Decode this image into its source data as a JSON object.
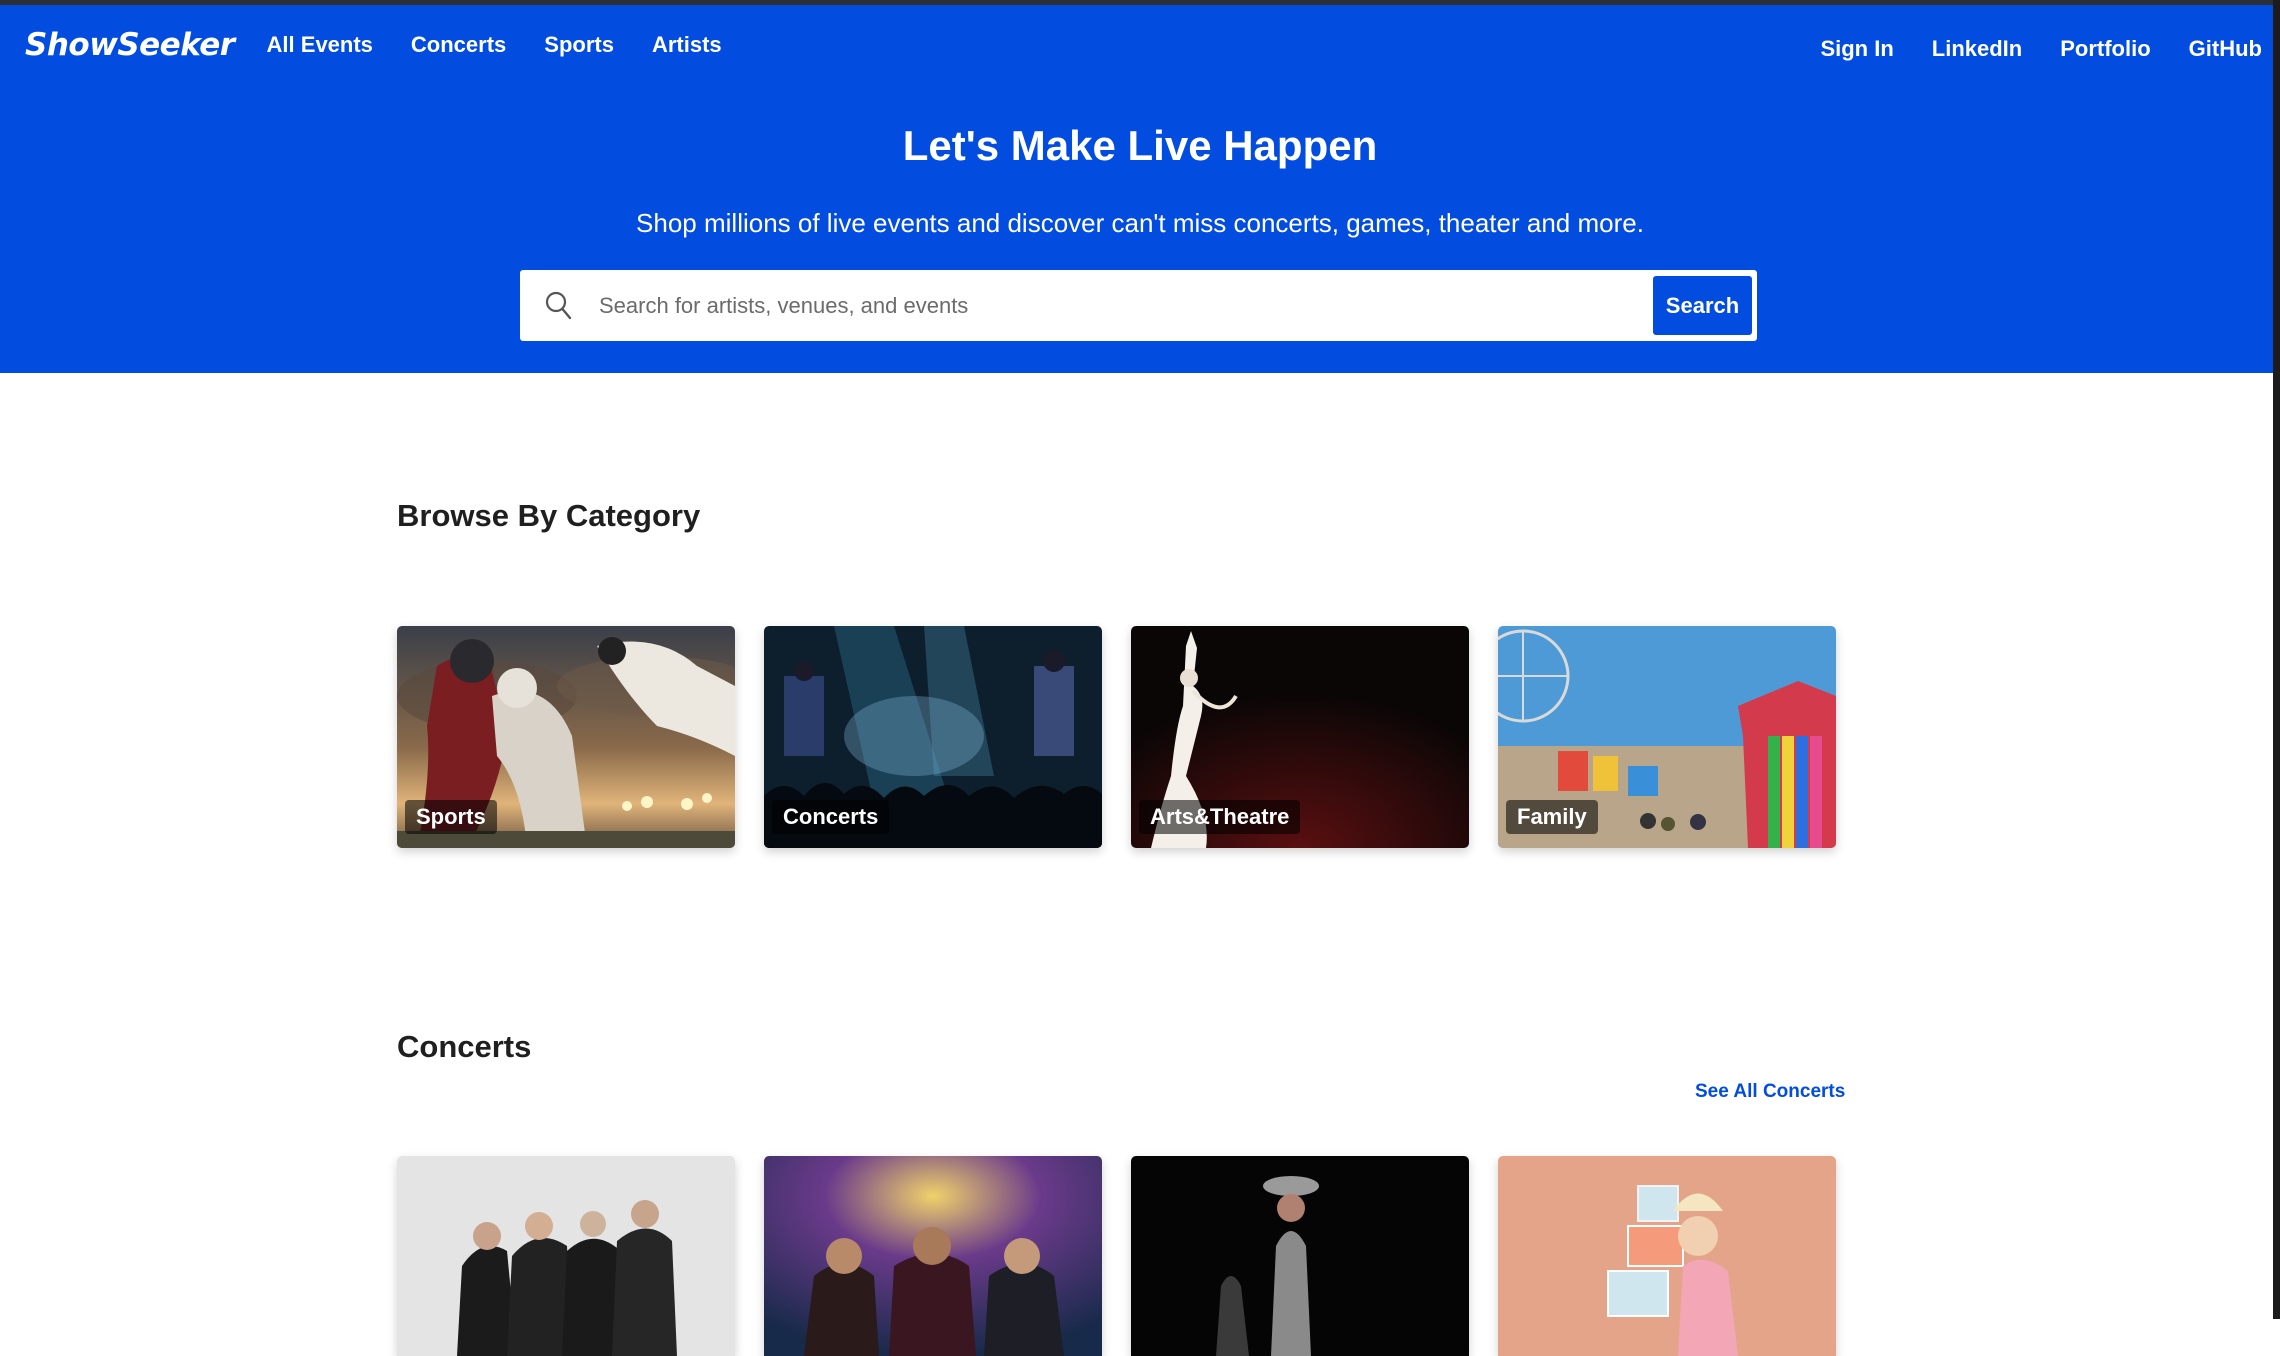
{
  "nav": {
    "brand": "ShowSeeker",
    "left_links": [
      "All Events",
      "Concerts",
      "Sports",
      "Artists"
    ],
    "right_links": [
      "Sign In",
      "LinkedIn",
      "Portfolio",
      "GitHub"
    ]
  },
  "hero": {
    "title": "Let's Make Live Happen",
    "subtitle": "Shop millions of live events and discover can't miss concerts, games, theater and more."
  },
  "search": {
    "placeholder": "Search for artists, venues, and events",
    "button_label": "Search"
  },
  "browse": {
    "title": "Browse By Category",
    "categories": [
      {
        "label": "Sports"
      },
      {
        "label": "Concerts"
      },
      {
        "label": "Arts&Theatre"
      },
      {
        "label": "Family"
      }
    ]
  },
  "concerts": {
    "title": "Concerts",
    "see_all": "See All Concerts"
  },
  "colors": {
    "brand_blue": "#024ddf",
    "text_dark": "#1f1f1f"
  }
}
